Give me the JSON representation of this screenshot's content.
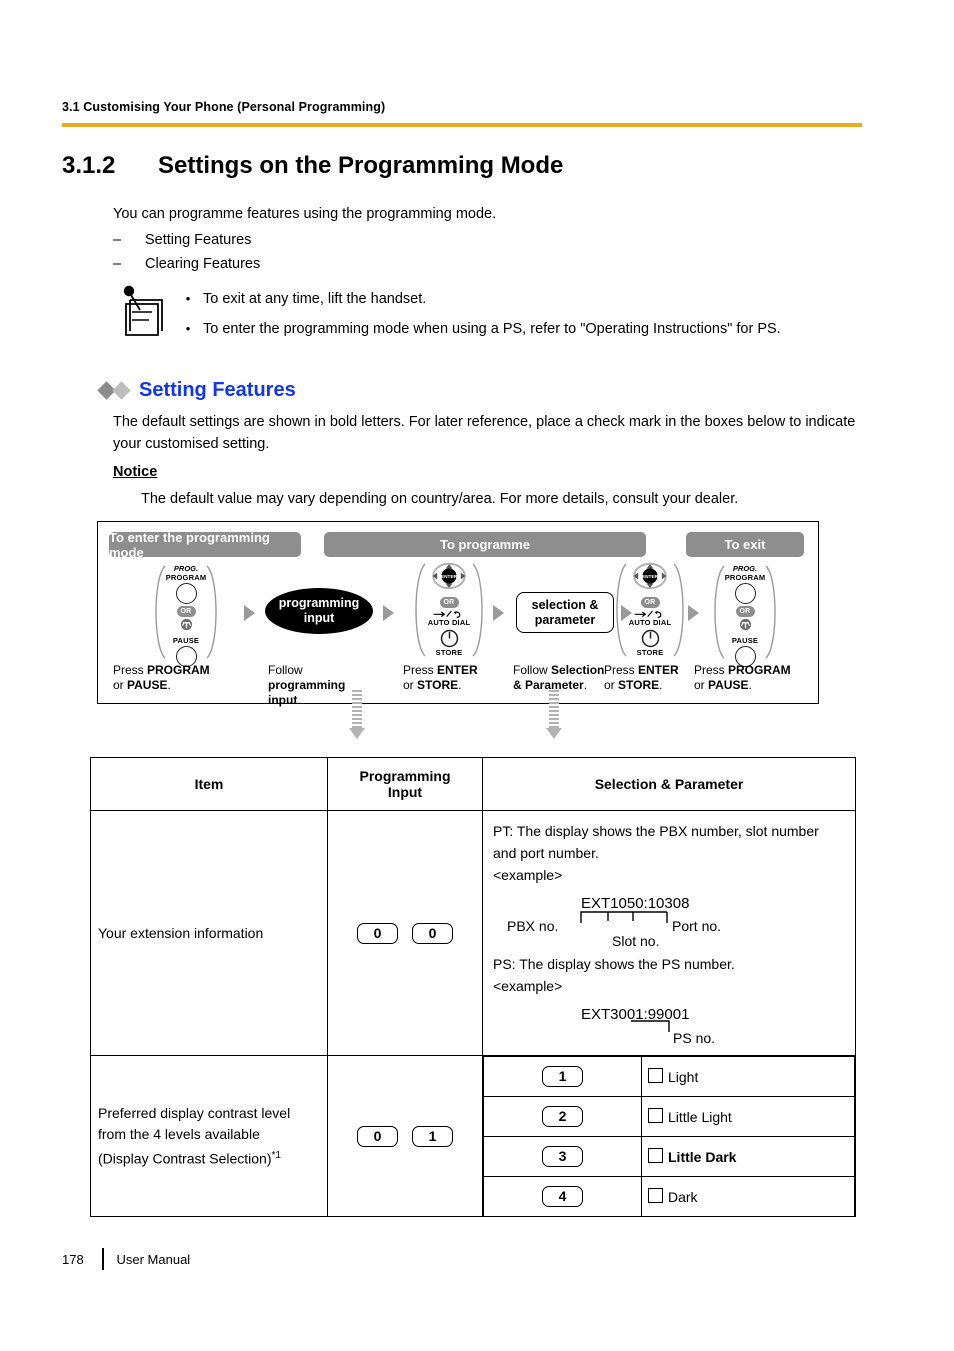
{
  "header": {
    "running_header": "3.1 Customising Your Phone (Personal Programming)"
  },
  "section": {
    "number": "3.1.2",
    "title": "Settings on the Programming Mode"
  },
  "intro": {
    "lead": "You can programme features using the programming mode.",
    "dash": "–",
    "items": [
      "Setting Features",
      "Clearing Features"
    ]
  },
  "note": {
    "icon": "note-pencil-icon",
    "bullet": "•",
    "items": [
      "To exit at any time, lift the handset.",
      "To enter the programming mode when using a PS, refer to \"Operating Instructions\" for PS."
    ]
  },
  "feature": {
    "heading": "Setting Features",
    "heading_color": "#1136e8",
    "body": "The default settings are shown in bold letters. For later reference, place a check mark in the boxes below to indicate your customised setting.",
    "notice_label": "Notice",
    "notice_body": "The default value may vary depending on country/area. For more details, consult your dealer."
  },
  "flow": {
    "bands": [
      {
        "label": "To enter the programming mode"
      },
      {
        "label": "To programme"
      },
      {
        "label": "To exit"
      }
    ],
    "keys": {
      "prog_italic": "PROG.",
      "program": "PROGRAM",
      "pause": "PAUSE",
      "or": "OR",
      "enter": "ENTER",
      "auto_dial": "AUTO DIAL",
      "store": "STORE"
    },
    "nodes": {
      "programming_input": "programming\ninput",
      "programming_input_l1": "programming",
      "programming_input_l2": "input",
      "selection_parameter_l1": "selection &",
      "selection_parameter_l2": "parameter"
    },
    "captions": [
      {
        "l1_plain": "Press ",
        "l1_bold": "PROGRAM",
        "l2_plain": "or ",
        "l2_bold": "PAUSE",
        "l2_tail": "."
      },
      {
        "l1_plain": "Follow",
        "l1_bold": "",
        "l2_bold": "programming",
        "l3_bold": "input",
        "l3_tail": "."
      },
      {
        "l1_plain": "Press ",
        "l1_bold": "ENTER",
        "l2_plain": "or ",
        "l2_bold": "STORE",
        "l2_tail": "."
      },
      {
        "l1_plain": "Follow ",
        "l1_bold": "Selection",
        "l2_bold": "& Parameter",
        "l2_tail": "."
      },
      {
        "l1_plain": "Press ",
        "l1_bold": "ENTER",
        "l2_plain": "or ",
        "l2_bold": "STORE",
        "l2_tail": "."
      },
      {
        "l1_plain": "Press ",
        "l1_bold": "PROGRAM",
        "l2_plain": "or ",
        "l2_bold": "PAUSE",
        "l2_tail": "."
      }
    ]
  },
  "table": {
    "columns": [
      "Item",
      "Programming\nInput",
      "Selection & Parameter"
    ],
    "col_item": "Item",
    "col_prog_l1": "Programming",
    "col_prog_l2": "Input",
    "col_sel": "Selection & Parameter",
    "rows": [
      {
        "item": "Your extension information",
        "keys": [
          "0",
          "0"
        ],
        "selection": {
          "pt_line1": "PT: The display shows the PBX number, slot number",
          "pt_line2": "and port number.",
          "example_label": "<example>",
          "pt_example": "EXT1050:10308",
          "ann_pbx": "PBX no.",
          "ann_slot": "Slot no.",
          "ann_port": "Port no.",
          "ps_line": "PS: The display shows the PS number.",
          "example_label2": "<example>",
          "ps_example": "EXT3001:99001",
          "ann_ps": "PS no."
        }
      },
      {
        "item_l1": "Preferred display contrast level",
        "item_l2": "from the 4 levels available",
        "item_l3": "(Display Contrast Selection)",
        "item_sup": "*1",
        "keys": [
          "0",
          "1"
        ],
        "options": [
          {
            "key": "1",
            "label": "Light",
            "bold": false
          },
          {
            "key": "2",
            "label": "Little Light",
            "bold": false
          },
          {
            "key": "3",
            "label": "Little Dark",
            "bold": true
          },
          {
            "key": "4",
            "label": "Dark",
            "bold": false
          }
        ]
      }
    ]
  },
  "footer": {
    "page_number": "178",
    "doc_label": "User Manual"
  }
}
